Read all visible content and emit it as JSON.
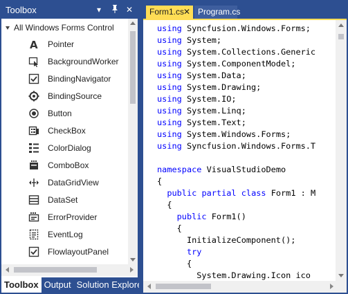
{
  "toolbox": {
    "title": "Toolbox",
    "controls": {
      "dropdown": "▾",
      "pin": "🖈",
      "close": "✕"
    },
    "group_label": "All Windows Forms Control",
    "items": [
      {
        "label": "Pointer",
        "icon": "pointer-icon"
      },
      {
        "label": "BackgroundWorker",
        "icon": "background-worker-icon"
      },
      {
        "label": "BindingNavigator",
        "icon": "binding-navigator-icon"
      },
      {
        "label": "BindingSource",
        "icon": "binding-source-icon"
      },
      {
        "label": "Button",
        "icon": "button-icon"
      },
      {
        "label": "CheckBox",
        "icon": "checkbox-icon"
      },
      {
        "label": "ColorDialog",
        "icon": "color-dialog-icon"
      },
      {
        "label": "ComboBox",
        "icon": "combobox-icon"
      },
      {
        "label": "DataGridView",
        "icon": "datagridview-icon"
      },
      {
        "label": "DataSet",
        "icon": "dataset-icon"
      },
      {
        "label": "ErrorProvider",
        "icon": "error-provider-icon"
      },
      {
        "label": "EventLog",
        "icon": "event-log-icon"
      },
      {
        "label": "FlowlayoutPanel",
        "icon": "flowlayout-panel-icon"
      }
    ],
    "bottom_tabs": [
      "Toolbox",
      "Output",
      "Solution Explorer"
    ]
  },
  "editor": {
    "tabs": [
      {
        "label": "Form1.cs",
        "close": "✕"
      },
      {
        "label": "Program.cs"
      }
    ],
    "code_lines": [
      [
        {
          "t": "using",
          "k": true
        },
        {
          "t": " Syncfusion.Windows.Forms;"
        }
      ],
      [
        {
          "t": "using",
          "k": true
        },
        {
          "t": " System;"
        }
      ],
      [
        {
          "t": "using",
          "k": true
        },
        {
          "t": " System.Collections.Generic"
        }
      ],
      [
        {
          "t": "using",
          "k": true
        },
        {
          "t": " System.ComponentModel;"
        }
      ],
      [
        {
          "t": "using",
          "k": true
        },
        {
          "t": " System.Data;"
        }
      ],
      [
        {
          "t": "using",
          "k": true
        },
        {
          "t": " System.Drawing;"
        }
      ],
      [
        {
          "t": "using",
          "k": true
        },
        {
          "t": " System.IO;"
        }
      ],
      [
        {
          "t": "using",
          "k": true
        },
        {
          "t": " System.Linq;"
        }
      ],
      [
        {
          "t": "using",
          "k": true
        },
        {
          "t": " System.Text;"
        }
      ],
      [
        {
          "t": "using",
          "k": true
        },
        {
          "t": " System.Windows.Forms;"
        }
      ],
      [
        {
          "t": "using",
          "k": true
        },
        {
          "t": " Syncfusion.Windows.Forms.T"
        }
      ],
      [],
      [
        {
          "t": "namespace",
          "k": true
        },
        {
          "t": " VisualStudioDemo"
        }
      ],
      [
        {
          "t": "{"
        }
      ],
      [
        {
          "t": "  "
        },
        {
          "t": "public",
          "k": true
        },
        {
          "t": " "
        },
        {
          "t": "partial",
          "k": true
        },
        {
          "t": " "
        },
        {
          "t": "class",
          "k": true
        },
        {
          "t": " Form1 : M"
        }
      ],
      [
        {
          "t": "  {"
        }
      ],
      [
        {
          "t": "    "
        },
        {
          "t": "public",
          "k": true
        },
        {
          "t": " Form1()"
        }
      ],
      [
        {
          "t": "    {"
        }
      ],
      [
        {
          "t": "      InitializeComponent();"
        }
      ],
      [
        {
          "t": "      "
        },
        {
          "t": "try",
          "k": true
        }
      ],
      [
        {
          "t": "      {"
        }
      ],
      [
        {
          "t": "        System.Drawing.Icon ico"
        }
      ]
    ]
  }
}
